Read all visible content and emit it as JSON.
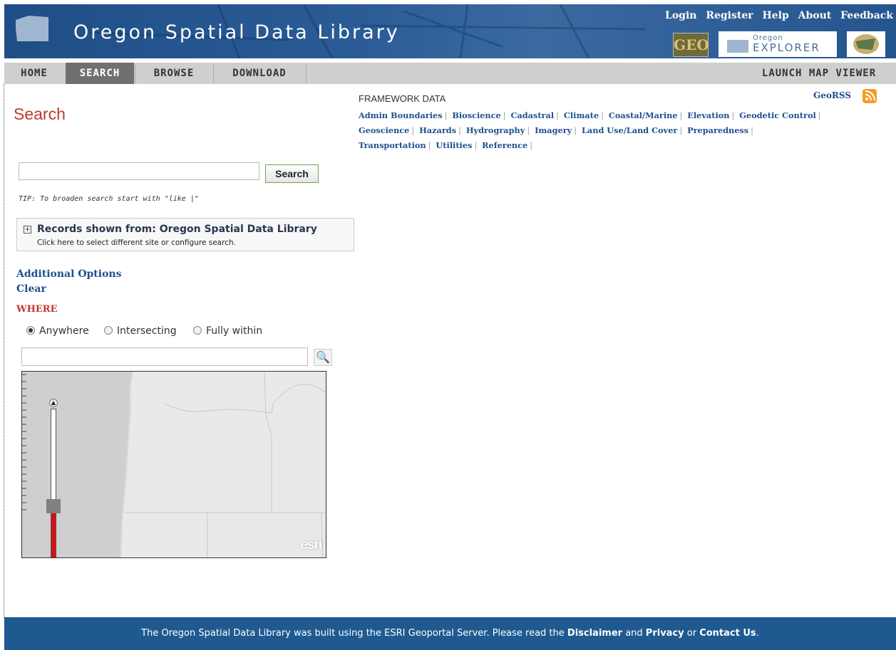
{
  "header": {
    "title": "Oregon Spatial Data Library",
    "top_links": [
      "Login",
      "Register",
      "Help",
      "About",
      "Feedback"
    ],
    "geo_badge": "GEO",
    "explorer_small": "Oregon",
    "explorer_big": "EXPLORER"
  },
  "nav": {
    "home": "HOME",
    "search": "SEARCH",
    "browse": "BROWSE",
    "download": "DOWNLOAD",
    "launch": "LAUNCH MAP VIEWER"
  },
  "framework": {
    "title": "FRAMEWORK DATA",
    "links": [
      "Admin Boundaries",
      "Bioscience",
      "Cadastral",
      "Climate",
      "Coastal/Marine",
      "Elevation",
      "Geodetic Control",
      "Geoscience",
      "Hazards",
      "Hydrography",
      "Imagery",
      "Land Use/Land Cover",
      "Preparedness",
      "Transportation",
      "Utilities",
      "Reference"
    ],
    "georss": "GeoRSS"
  },
  "search": {
    "title": "Search",
    "button": "Search",
    "query_value": "",
    "tip": "TIP: To broaden search start with \"like |\""
  },
  "records": {
    "title": "Records shown from: Oregon Spatial Data Library",
    "subtitle": "Click here to select different site or configure search."
  },
  "options": {
    "additional": "Additional Options",
    "clear": "Clear",
    "where": "WHERE",
    "radios": [
      {
        "label": "Anywhere",
        "selected": true
      },
      {
        "label": "Intersecting",
        "selected": false
      },
      {
        "label": "Fully within",
        "selected": false
      }
    ]
  },
  "map": {
    "attribution": "esri",
    "zoom_level_fraction": 0.35
  },
  "footer": {
    "pre": "The Oregon Spatial Data Library was built using the ESRI Geoportal Server. Please read the ",
    "disclaimer": "Disclaimer",
    "and": " and ",
    "privacy": "Privacy",
    "or": " or ",
    "contact": "Contact Us",
    "end": "."
  },
  "colors": {
    "header_blue": "#1f4e86",
    "accent_red": "#c0392b",
    "link_blue": "#1f4f8f",
    "footer_blue": "#1e5a8f"
  }
}
